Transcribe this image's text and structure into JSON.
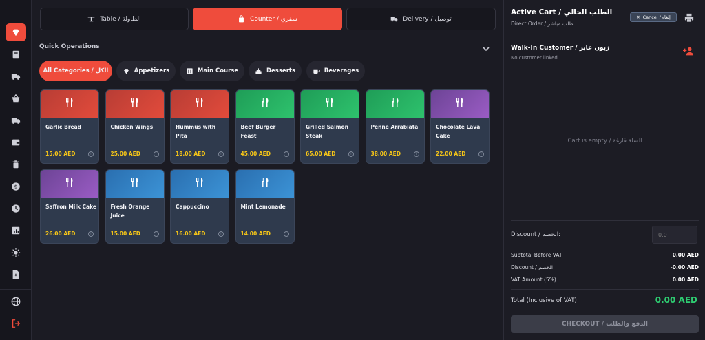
{
  "sidebar": {
    "items": [
      {
        "icon": "gem-icon",
        "active": true
      },
      {
        "icon": "book-icon"
      },
      {
        "icon": "truck-icon"
      },
      {
        "icon": "basket-icon"
      },
      {
        "icon": "delivery-truck-icon"
      },
      {
        "icon": "wallet-icon"
      },
      {
        "icon": "trash-icon"
      },
      {
        "icon": "dollar-icon"
      },
      {
        "icon": "clock-icon"
      },
      {
        "icon": "chart-icon"
      },
      {
        "icon": "sun-icon"
      },
      {
        "icon": "file-icon"
      }
    ],
    "bottom": [
      {
        "icon": "globe-icon"
      },
      {
        "icon": "logout-icon"
      }
    ]
  },
  "order_modes": [
    {
      "label": "Table / الطاولة",
      "icon": "table-icon",
      "active": false
    },
    {
      "label": "Counter / سفري",
      "icon": "bag-icon",
      "active": true
    },
    {
      "label": "Delivery / توصيل",
      "icon": "truck-icon",
      "active": false
    }
  ],
  "quick_ops": {
    "title": "Quick Operations"
  },
  "categories": [
    {
      "label": "All Categories / الكل",
      "active": true
    },
    {
      "label": "Appetizers",
      "icon": "gem-icon"
    },
    {
      "label": "Main Course",
      "icon": "utensils-icon"
    },
    {
      "label": "Desserts",
      "icon": "cake-icon"
    },
    {
      "label": "Beverages",
      "icon": "cup-icon"
    }
  ],
  "products": [
    {
      "name": "Garlic Bread",
      "price": "15.00 AED",
      "color": "red"
    },
    {
      "name": "Chicken Wings",
      "price": "25.00 AED",
      "color": "red"
    },
    {
      "name": "Hummus with Pita",
      "price": "18.00 AED",
      "color": "red"
    },
    {
      "name": "Beef Burger Feast",
      "price": "45.00 AED",
      "color": "green"
    },
    {
      "name": "Grilled Salmon Steak",
      "price": "65.00 AED",
      "color": "green"
    },
    {
      "name": "Penne Arrabiata",
      "price": "38.00 AED",
      "color": "green"
    },
    {
      "name": "Chocolate Lava Cake",
      "price": "22.00 AED",
      "color": "purple"
    },
    {
      "name": "Saffron Milk Cake",
      "price": "26.00 AED",
      "color": "purple"
    },
    {
      "name": "Fresh Orange Juice",
      "price": "15.00 AED",
      "color": "blue"
    },
    {
      "name": "Cappuccino",
      "price": "16.00 AED",
      "color": "blue"
    },
    {
      "name": "Mint Lemonade",
      "price": "14.00 AED",
      "color": "blue"
    }
  ],
  "cart": {
    "title": "Active Cart / الطلب الحالي",
    "subtitle": "Direct Order / طلب مباشر",
    "cancel_label": "Cancel / إلغاء",
    "customer_name": "Walk-In Customer / زبون عابر",
    "customer_sub": "No customer linked",
    "empty_text": "Cart is empty / السلة فارغة",
    "discount_label": "Discount / الخصم:",
    "discount_placeholder": "0.0",
    "subtotal_label": "Subtotal Before VAT",
    "subtotal_value": "0.00 AED",
    "discount_row_label": "Discount / الخصم",
    "discount_row_value": "-0.00 AED",
    "vat_label": "VAT Amount (5%)",
    "vat_value": "0.00 AED",
    "total_label": "Total (Inclusive of VAT)",
    "total_value": "0.00 AED",
    "checkout_label": "CHECKOUT / الدفع والطلب"
  },
  "colors": {
    "accent": "#ef4c3c",
    "price": "#f5c518",
    "total": "#2ecc71"
  }
}
